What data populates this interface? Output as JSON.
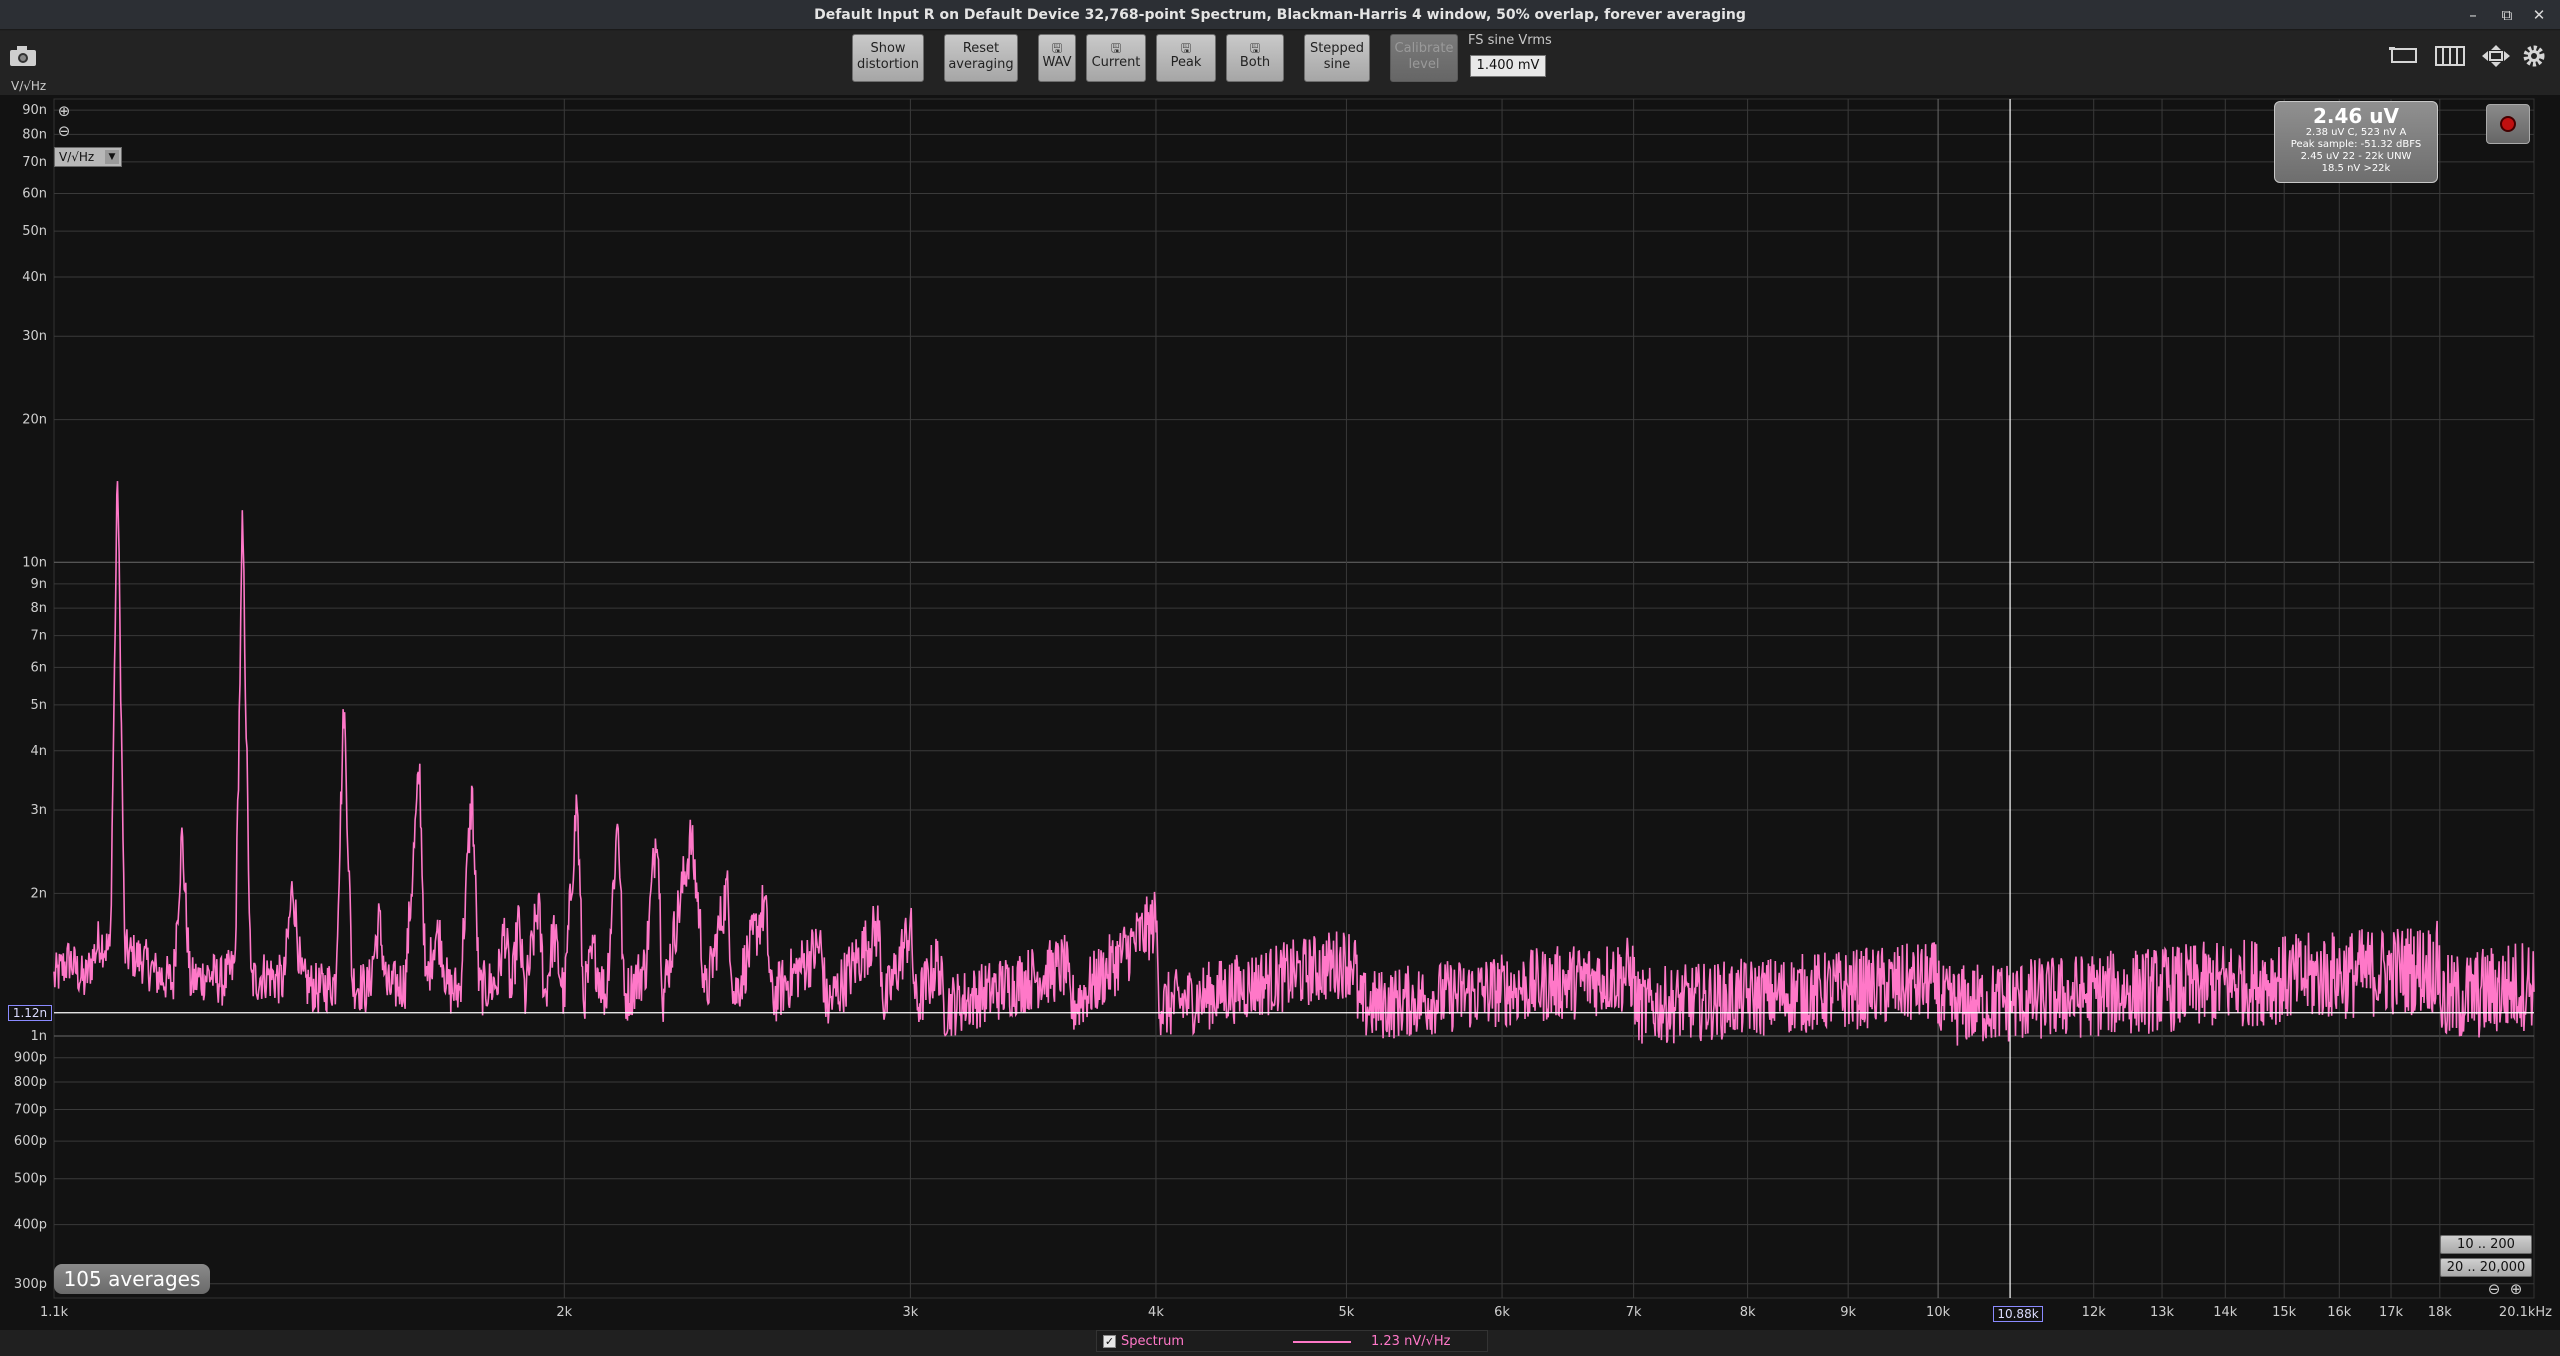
{
  "window": {
    "title": "Default Input R on Default Device 32,768-point Spectrum, Blackman-Harris 4 window, 50% overlap, forever averaging",
    "minimize_glyph": "–",
    "maximize_glyph": "⧉",
    "close_glyph": "✕"
  },
  "toolbar": {
    "show_distortion": [
      "Show",
      "distortion"
    ],
    "reset_averaging": [
      "Reset",
      "averaging"
    ],
    "wav": "WAV",
    "current": "Current",
    "peak": "Peak",
    "both": "Both",
    "stepped_sine": [
      "Stepped",
      "sine"
    ],
    "calibrate": [
      "Calibrate",
      "level"
    ],
    "fs_label": "FS sine Vrms",
    "fs_value": "1.400 mV",
    "save_glyph": "🖫",
    "camera_icon": "camera-icon"
  },
  "plot": {
    "y_unit": "V/√Hz",
    "unit_select": "V/√Hz",
    "y_cursor": "1.12n",
    "x_cursor": "10.88k",
    "averages": "105 averages",
    "range_low": "10 .. 200",
    "range_high": "20 .. 20,000",
    "zoom_in": "⊕",
    "zoom_out": "⊖"
  },
  "readout": {
    "main": "2.46 uV",
    "line1": "2.38 uV C, 523 nV A",
    "line2": "Peak sample: -51.32 dBFS",
    "line3": "2.45 uV 22 - 22k UNW",
    "line4": "18.5 nV >22k"
  },
  "legend": {
    "checked": "✓",
    "name": "Spectrum",
    "value": "1.23 nV/√Hz"
  },
  "colors": {
    "trace": "#ff78c8",
    "cursor": "#ffffff",
    "grid": "#3a3a3a",
    "grid_major": "#6a6a6a",
    "background": "#121212"
  },
  "chart_data": {
    "type": "line",
    "title": "",
    "xlabel": "",
    "ylabel": "V/√Hz",
    "x_scale": "log",
    "y_scale": "log",
    "xlim": [
      1100,
      20100
    ],
    "ylim": [
      2.8e-10,
      9.5e-08
    ],
    "grid": true,
    "legend_position": "bottom-center",
    "x_ticks": [
      {
        "value": 1100,
        "label": "1.1k"
      },
      {
        "value": 2000,
        "label": "2k"
      },
      {
        "value": 3000,
        "label": "3k"
      },
      {
        "value": 4000,
        "label": "4k"
      },
      {
        "value": 5000,
        "label": "5k"
      },
      {
        "value": 6000,
        "label": "6k"
      },
      {
        "value": 7000,
        "label": "7k"
      },
      {
        "value": 8000,
        "label": "8k"
      },
      {
        "value": 9000,
        "label": "9k"
      },
      {
        "value": 10000,
        "label": "10k"
      },
      {
        "value": 12000,
        "label": "12k"
      },
      {
        "value": 13000,
        "label": "13k"
      },
      {
        "value": 14000,
        "label": "14k"
      },
      {
        "value": 15000,
        "label": "15k"
      },
      {
        "value": 16000,
        "label": "16k"
      },
      {
        "value": 17000,
        "label": "17k"
      },
      {
        "value": 18000,
        "label": "18k"
      },
      {
        "value": 20100,
        "label": "20.1kHz"
      }
    ],
    "y_ticks": [
      {
        "value": 9e-08,
        "label": "90n"
      },
      {
        "value": 8e-08,
        "label": "80n"
      },
      {
        "value": 7e-08,
        "label": "70n"
      },
      {
        "value": 6e-08,
        "label": "60n"
      },
      {
        "value": 5e-08,
        "label": "50n"
      },
      {
        "value": 4e-08,
        "label": "40n"
      },
      {
        "value": 3e-08,
        "label": "30n"
      },
      {
        "value": 2e-08,
        "label": "20n"
      },
      {
        "value": 1e-08,
        "label": "10n"
      },
      {
        "value": 9e-09,
        "label": "9n"
      },
      {
        "value": 8e-09,
        "label": "8n"
      },
      {
        "value": 7e-09,
        "label": "7n"
      },
      {
        "value": 6e-09,
        "label": "6n"
      },
      {
        "value": 5e-09,
        "label": "5n"
      },
      {
        "value": 4e-09,
        "label": "4n"
      },
      {
        "value": 3e-09,
        "label": "3n"
      },
      {
        "value": 2e-09,
        "label": "2n"
      },
      {
        "value": 1e-09,
        "label": "1n"
      },
      {
        "value": 9e-10,
        "label": "900p"
      },
      {
        "value": 8e-10,
        "label": "800p"
      },
      {
        "value": 7e-10,
        "label": "700p"
      },
      {
        "value": 6e-10,
        "label": "600p"
      },
      {
        "value": 5e-10,
        "label": "500p"
      },
      {
        "value": 4e-10,
        "label": "400p"
      },
      {
        "value": 3e-10,
        "label": "300p"
      }
    ],
    "cursor": {
      "x": 10880,
      "y": 1.12e-09
    },
    "series": [
      {
        "name": "Spectrum",
        "noise_floor": 1.18e-09,
        "points": [
          [
            1100,
            1.32e-09
          ],
          [
            1120,
            1.45e-09
          ],
          [
            1140,
            1.3e-09
          ],
          [
            1160,
            1.6e-09
          ],
          [
            1175,
            1.5e-09
          ],
          [
            1185,
            1.6e-08
          ],
          [
            1195,
            1.5e-09
          ],
          [
            1220,
            1.45e-09
          ],
          [
            1240,
            1.35e-09
          ],
          [
            1265,
            1.3e-09
          ],
          [
            1278,
            2.65e-09
          ],
          [
            1290,
            1.3e-09
          ],
          [
            1320,
            1.35e-09
          ],
          [
            1340,
            1.3e-09
          ],
          [
            1360,
            1.4e-09
          ],
          [
            1372,
            1.25e-08
          ],
          [
            1385,
            1.3e-09
          ],
          [
            1410,
            1.35e-09
          ],
          [
            1440,
            1.3e-09
          ],
          [
            1455,
            2.1e-09
          ],
          [
            1470,
            1.3e-09
          ],
          [
            1500,
            1.25e-09
          ],
          [
            1530,
            1.3e-09
          ],
          [
            1545,
            5.1e-09
          ],
          [
            1560,
            1.3e-09
          ],
          [
            1590,
            1.25e-09
          ],
          [
            1610,
            1.75e-09
          ],
          [
            1625,
            1.25e-09
          ],
          [
            1660,
            1.3e-09
          ],
          [
            1688,
            3.7e-09
          ],
          [
            1700,
            1.25e-09
          ],
          [
            1720,
            1.65e-09
          ],
          [
            1730,
            1.6e-09
          ],
          [
            1745,
            1.25e-09
          ],
          [
            1770,
            1.25e-09
          ],
          [
            1795,
            3.3e-09
          ],
          [
            1810,
            1.25e-09
          ],
          [
            1850,
            1.3e-09
          ],
          [
            1865,
            1.7e-09
          ],
          [
            1880,
            1.2e-09
          ],
          [
            1895,
            1.75e-09
          ],
          [
            1910,
            1.2e-09
          ],
          [
            1940,
            1.9e-09
          ],
          [
            1955,
            1.2e-09
          ],
          [
            1975,
            1.65e-09
          ],
          [
            2000,
            1.2e-09
          ],
          [
            2030,
            3.2e-09
          ],
          [
            2045,
            1.2e-09
          ],
          [
            2070,
            1.5e-09
          ],
          [
            2100,
            1.2e-09
          ],
          [
            2130,
            2.95e-09
          ],
          [
            2145,
            1.2e-09
          ],
          [
            2200,
            1.4e-09
          ],
          [
            2230,
            2.9e-09
          ],
          [
            2245,
            1.2e-09
          ],
          [
            2320,
            2.6e-09
          ],
          [
            2340,
            1.9e-09
          ],
          [
            2360,
            1.2e-09
          ],
          [
            2420,
            2.05e-09
          ],
          [
            2440,
            1.2e-09
          ],
          [
            2530,
            1.9e-09
          ],
          [
            2550,
            1.2e-09
          ],
          [
            2700,
            1.55e-09
          ],
          [
            2720,
            1.15e-09
          ],
          [
            2890,
            1.7e-09
          ],
          [
            2910,
            1.15e-09
          ],
          [
            3000,
            1.7e-09
          ],
          [
            3020,
            1.15e-09
          ],
          [
            3100,
            1.45e-09
          ],
          [
            3120,
            1.15e-09
          ],
          [
            3600,
            1.4e-09
          ],
          [
            3620,
            1.15e-09
          ],
          [
            4000,
            1.75e-09
          ],
          [
            4020,
            1.15e-09
          ],
          [
            5050,
            1.45e-09
          ],
          [
            5070,
            1.15e-09
          ],
          [
            7000,
            1.35e-09
          ],
          [
            7020,
            1.15e-09
          ],
          [
            10000,
            1.3e-09
          ],
          [
            10020,
            1.15e-09
          ],
          [
            18000,
            1.4e-09
          ],
          [
            18020,
            1.18e-09
          ],
          [
            20100,
            1.3e-09
          ]
        ]
      }
    ]
  }
}
